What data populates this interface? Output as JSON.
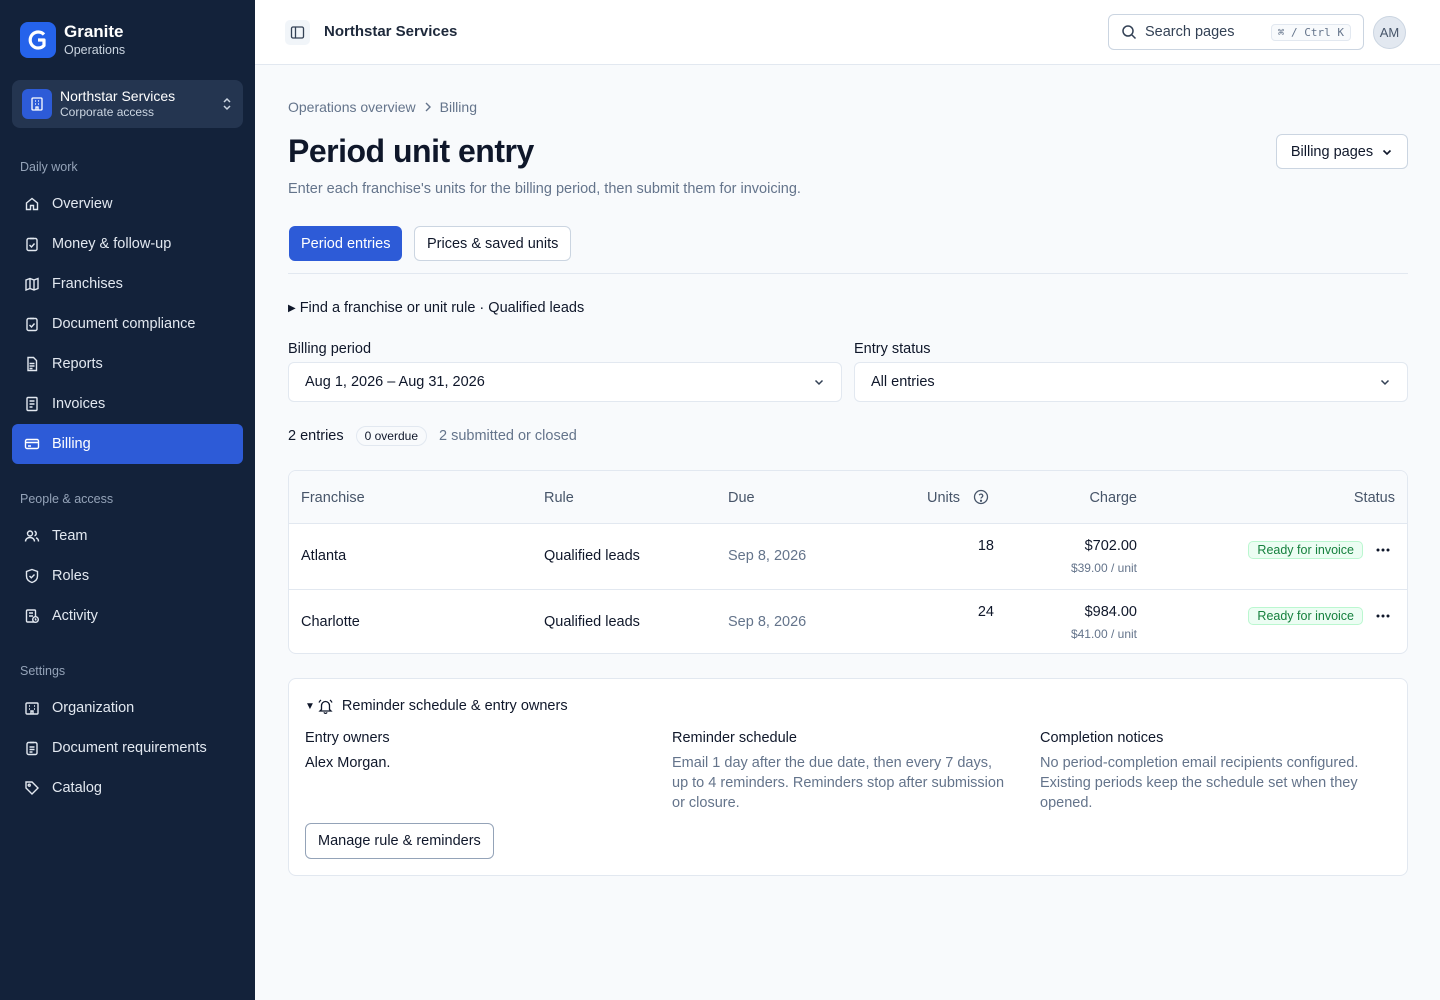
{
  "brand": {
    "name": "Granite",
    "subtitle": "Operations",
    "logo_letter": "G"
  },
  "org": {
    "name": "Northstar Services",
    "subtitle": "Corporate access"
  },
  "sidebar": {
    "sections": [
      {
        "label": "Daily work",
        "items": [
          {
            "label": "Overview",
            "icon": "home-icon"
          },
          {
            "label": "Money & follow-up",
            "icon": "clipboard-check-icon"
          },
          {
            "label": "Franchises",
            "icon": "map-icon"
          },
          {
            "label": "Document compliance",
            "icon": "clipboard-check-icon"
          },
          {
            "label": "Reports",
            "icon": "file-text-icon"
          },
          {
            "label": "Invoices",
            "icon": "receipt-icon"
          },
          {
            "label": "Billing",
            "icon": "credit-card-icon",
            "active": true
          }
        ]
      },
      {
        "label": "People & access",
        "items": [
          {
            "label": "Team",
            "icon": "users-icon"
          },
          {
            "label": "Roles",
            "icon": "shield-check-icon"
          },
          {
            "label": "Activity",
            "icon": "history-icon"
          }
        ]
      },
      {
        "label": "Settings",
        "items": [
          {
            "label": "Organization",
            "icon": "building-icon"
          },
          {
            "label": "Document requirements",
            "icon": "clipboard-list-icon"
          },
          {
            "label": "Catalog",
            "icon": "tag-icon"
          }
        ]
      }
    ]
  },
  "topbar": {
    "title": "Northstar Services",
    "search": {
      "placeholder": "Search pages",
      "shortcut": "⌘ / Ctrl K"
    },
    "avatar_initials": "AM"
  },
  "breadcrumb": {
    "parent": "Operations overview",
    "current": "Billing"
  },
  "page": {
    "title": "Period unit entry",
    "description": "Enter each franchise's units for the billing period, then submit them for invoicing.",
    "menu_button": "Billing pages"
  },
  "tabs": [
    {
      "label": "Period entries",
      "active": true
    },
    {
      "label": "Prices & saved units",
      "active": false
    }
  ],
  "finder": {
    "label": "Find a franchise or unit rule · Qualified leads"
  },
  "filters": {
    "billing_period": {
      "label": "Billing period",
      "value": "Aug 1, 2026 – Aug 31, 2026"
    },
    "entry_status": {
      "label": "Entry status",
      "value": "All entries"
    }
  },
  "summary": {
    "count": "2 entries",
    "overdue": "0 overdue",
    "submitted": "2 submitted or closed"
  },
  "table": {
    "headers": {
      "franchise": "Franchise",
      "rule": "Rule",
      "due": "Due",
      "units": "Units",
      "charge": "Charge",
      "status": "Status"
    },
    "rows": [
      {
        "franchise": "Atlanta",
        "rule": "Qualified leads",
        "due": "Sep 8, 2026",
        "units": "18",
        "charge": "$702.00",
        "unit_price": "$39.00 / unit",
        "status": "Ready for invoice"
      },
      {
        "franchise": "Charlotte",
        "rule": "Qualified leads",
        "due": "Sep 8, 2026",
        "units": "24",
        "charge": "$984.00",
        "unit_price": "$41.00 / unit",
        "status": "Ready for invoice"
      }
    ]
  },
  "reminders": {
    "title": "Reminder schedule & entry owners",
    "owners": {
      "title": "Entry owners",
      "text": "Alex Morgan."
    },
    "schedule": {
      "title": "Reminder schedule",
      "text": "Email 1 day after the due date, then every 7 days, up to 4 reminders. Reminders stop after submission or closure."
    },
    "notices": {
      "title": "Completion notices",
      "text": "No period-completion email recipients configured. Existing periods keep the schedule set when they opened."
    },
    "button": "Manage rule & reminders"
  },
  "colors": {
    "sidebar_bg": "#13223a",
    "accent": "#2d5bd7",
    "status_green": "#15803d"
  }
}
